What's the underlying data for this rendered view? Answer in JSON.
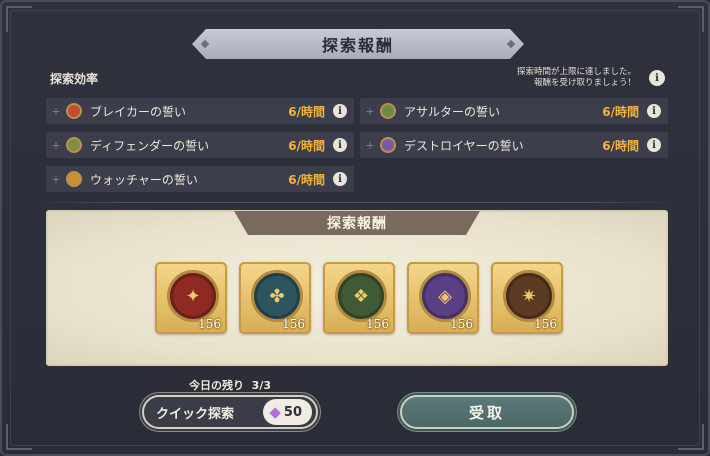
{
  "header": {
    "title": "探索報酬"
  },
  "efficiency": {
    "label": "探索効率",
    "notice_line1": "探索時間が上限に達しました。",
    "notice_line2": "報酬を受け取りましょう！",
    "rows": [
      {
        "name": "ブレイカーの誓い",
        "rate": "6/時間",
        "medal_color": "#c0502c"
      },
      {
        "name": "アサルターの誓い",
        "rate": "6/時間",
        "medal_color": "#6f8a46"
      },
      {
        "name": "ディフェンダーの誓い",
        "rate": "6/時間",
        "medal_color": "#7f8f40"
      },
      {
        "name": "デストロイヤーの誓い",
        "rate": "6/時間",
        "medal_color": "#7b5aa3"
      },
      {
        "name": "ウォッチャーの誓い",
        "rate": "6/時間",
        "medal_color": "#c8902e"
      }
    ]
  },
  "rewards": {
    "title": "探索報酬",
    "items": [
      {
        "count": "156",
        "icon": "breaker-medal-icon",
        "color": "#8e2a22"
      },
      {
        "count": "156",
        "icon": "defender-medal-icon",
        "color": "#2c5560"
      },
      {
        "count": "156",
        "icon": "assaulter-medal-icon",
        "color": "#3f5a35"
      },
      {
        "count": "156",
        "icon": "destroyer-medal-icon",
        "color": "#5a3f86"
      },
      {
        "count": "156",
        "icon": "watcher-medal-icon",
        "color": "#5a3b22"
      }
    ]
  },
  "footer": {
    "remaining_label": "今日の残り",
    "remaining_value": "3/3",
    "quick_label": "クイック探索",
    "quick_cost": "50",
    "claim_label": "受取"
  }
}
